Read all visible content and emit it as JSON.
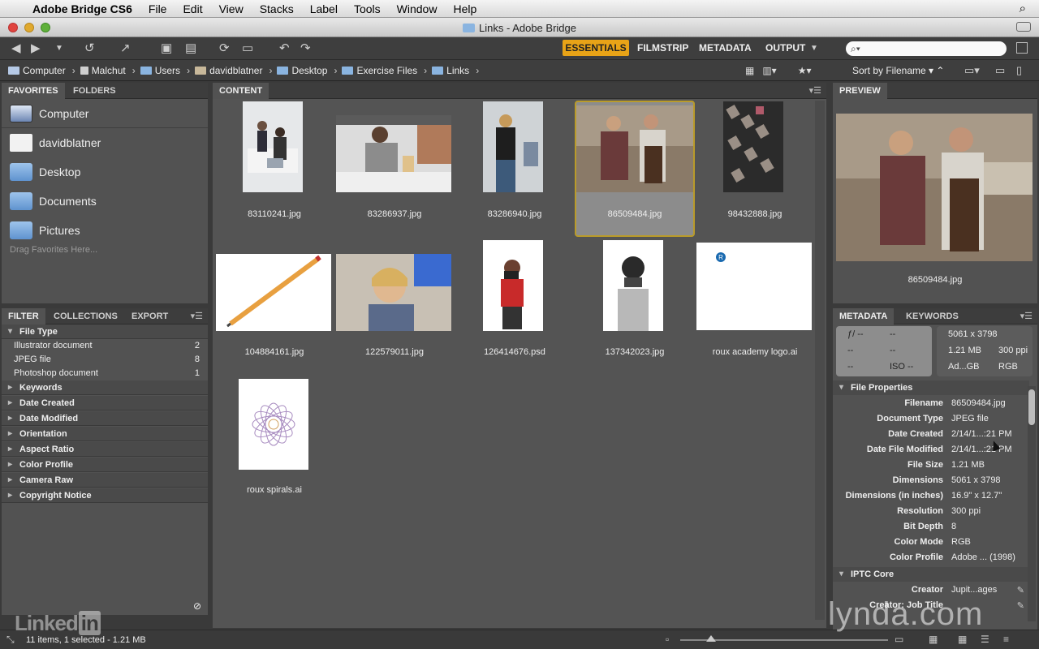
{
  "menubar": {
    "app_name": "Adobe Bridge CS6",
    "menus": [
      "File",
      "Edit",
      "View",
      "Stacks",
      "Label",
      "Tools",
      "Window",
      "Help"
    ]
  },
  "window": {
    "title": "Links - Adobe Bridge"
  },
  "toolbar": {
    "workspaces": [
      "ESSENTIALS",
      "FILMSTRIP",
      "METADATA",
      "OUTPUT"
    ],
    "active_workspace": "ESSENTIALS",
    "search_placeholder": ""
  },
  "path": {
    "crumbs": [
      "Computer",
      "Malchut",
      "Users",
      "davidblatner",
      "Desktop",
      "Exercise Files",
      "Links"
    ],
    "sort_label": "Sort by Filename"
  },
  "favorites_panel": {
    "tabs": [
      "FAVORITES",
      "FOLDERS"
    ],
    "items": [
      "Computer",
      "davidblatner",
      "Desktop",
      "Documents",
      "Pictures"
    ],
    "hint": "Drag Favorites Here..."
  },
  "filter_panel": {
    "tabs": [
      "FILTER",
      "COLLECTIONS",
      "EXPORT"
    ],
    "file_type_heading": "File Type",
    "file_types": [
      {
        "label": "Illustrator document",
        "count": "2"
      },
      {
        "label": "JPEG file",
        "count": "8"
      },
      {
        "label": "Photoshop document",
        "count": "1"
      }
    ],
    "sections": [
      "Keywords",
      "Date Created",
      "Date Modified",
      "Orientation",
      "Aspect Ratio",
      "Color Profile",
      "Camera Raw",
      "Copyright Notice"
    ]
  },
  "content_panel": {
    "tab": "CONTENT",
    "files": [
      "83110241.jpg",
      "83286937.jpg",
      "83286940.jpg",
      "86509484.jpg",
      "98432888.jpg",
      "104884161.jpg",
      "122579011.jpg",
      "126414676.psd",
      "137342023.jpg",
      "roux academy logo.ai",
      "roux spirals.ai"
    ],
    "selected_file": "86509484.jpg"
  },
  "preview_panel": {
    "tab": "PREVIEW",
    "filename": "86509484.jpg"
  },
  "metadata_panel": {
    "tabs": [
      "METADATA",
      "KEYWORDS"
    ],
    "camera": {
      "fstop": "ƒ/ --",
      "shutter": "--",
      "a": "--",
      "b": "--",
      "c": "--",
      "iso": "ISO --"
    },
    "summary": {
      "dimensions": "5061 x 3798",
      "size": "1.21 MB",
      "ppi": "300 ppi",
      "profile": "Ad...GB",
      "mode": "RGB"
    },
    "file_properties_heading": "File Properties",
    "file_properties": [
      {
        "key": "Filename",
        "value": "86509484.jpg"
      },
      {
        "key": "Document Type",
        "value": "JPEG file"
      },
      {
        "key": "Date Created",
        "value": "2/14/1...:21 PM"
      },
      {
        "key": "Date File Modified",
        "value": "2/14/1...:21 PM"
      },
      {
        "key": "File Size",
        "value": "1.21 MB"
      },
      {
        "key": "Dimensions",
        "value": "5061 x 3798"
      },
      {
        "key": "Dimensions (in inches)",
        "value": "16.9\" x 12.7\""
      },
      {
        "key": "Resolution",
        "value": "300 ppi"
      },
      {
        "key": "Bit Depth",
        "value": "8"
      },
      {
        "key": "Color Mode",
        "value": "RGB"
      },
      {
        "key": "Color Profile",
        "value": "Adobe ... (1998)"
      }
    ],
    "iptc_heading": "IPTC Core",
    "iptc": [
      {
        "key": "Creator",
        "value": "Jupit...ages"
      },
      {
        "key": "Creator: Job Title",
        "value": ""
      }
    ]
  },
  "statusbar": {
    "text": "11 items, 1 selected - 1.21 MB"
  },
  "watermarks": {
    "linkedin": "Linked",
    "linkedin_in": "in",
    "lynda": "lynda.com"
  },
  "colors": {
    "accent": "#e8a317",
    "panel": "#525252",
    "selection_border": "#b99b2a"
  }
}
